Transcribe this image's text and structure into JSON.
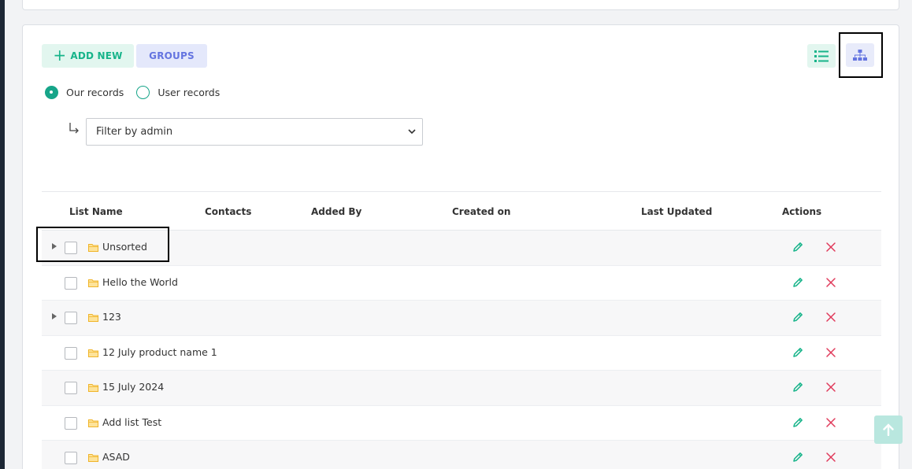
{
  "toolbar": {
    "add_new_label": "ADD NEW",
    "groups_label": "GROUPS",
    "list_view_icon": "list-view-icon",
    "tree_view_icon": "sitemap-icon"
  },
  "records_filter": {
    "options": [
      "Our records",
      "User records"
    ],
    "selected": "Our records"
  },
  "admin_filter": {
    "selected": "Filter by admin"
  },
  "table": {
    "columns": [
      "List Name",
      "Contacts",
      "Added By",
      "Created on",
      "Last Updated",
      "Actions"
    ],
    "rows": [
      {
        "name": "Unsorted",
        "expandable": true
      },
      {
        "name": "Hello the World",
        "expandable": false
      },
      {
        "name": "123",
        "expandable": true
      },
      {
        "name": "12 July product name 1",
        "expandable": false
      },
      {
        "name": "15 July 2024",
        "expandable": false
      },
      {
        "name": "Add list Test",
        "expandable": false
      },
      {
        "name": "ASAD",
        "expandable": false
      }
    ]
  },
  "colors": {
    "accent_green": "#17b48a",
    "accent_blue": "#6474e0",
    "delete_red": "#e0395a"
  }
}
